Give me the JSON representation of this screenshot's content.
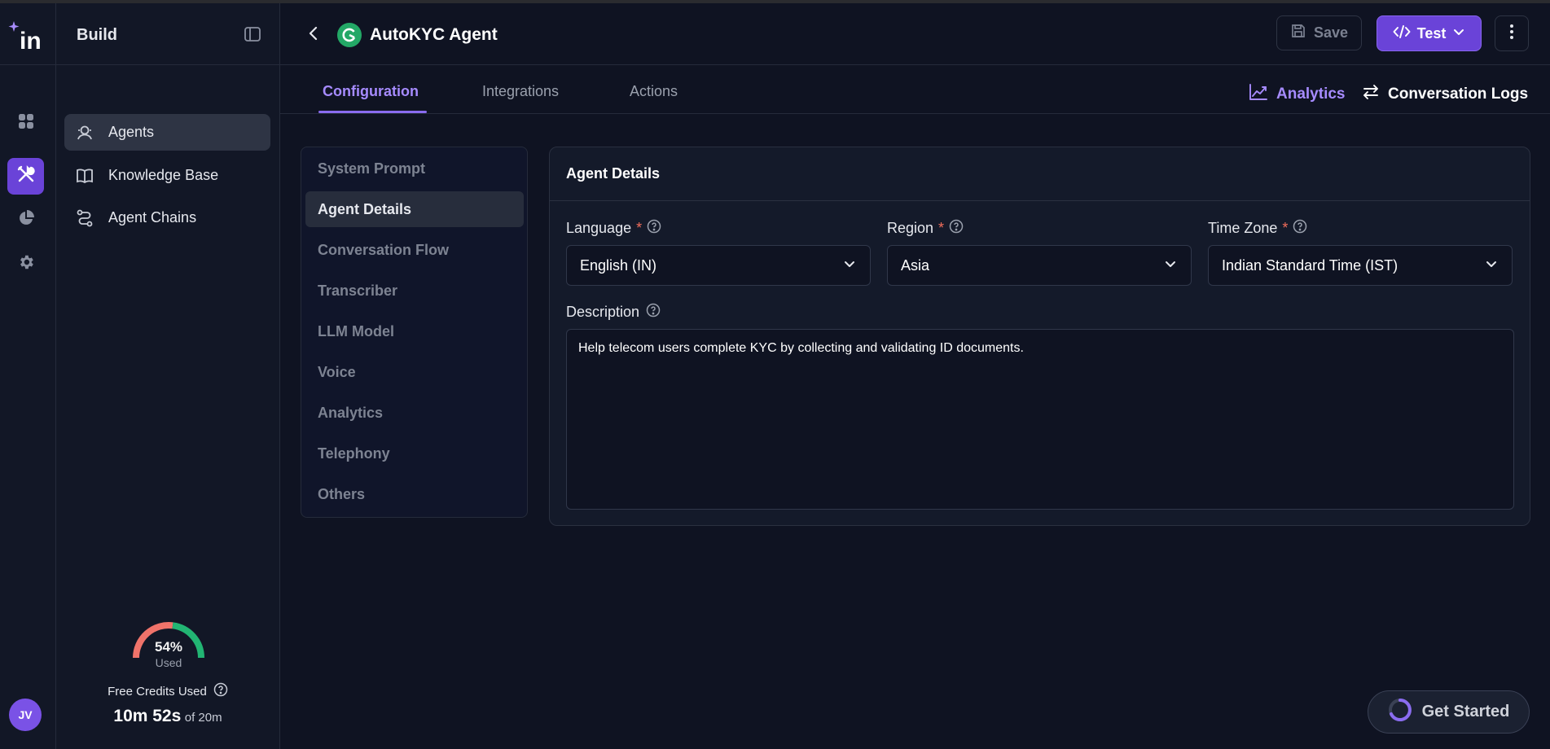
{
  "brand": {
    "logo_text": "in"
  },
  "rail": {
    "items": [
      {
        "icon": "grid-icon"
      },
      {
        "icon": "tools-icon",
        "active": true
      },
      {
        "icon": "pie-chart-icon"
      },
      {
        "icon": "gear-icon"
      }
    ],
    "avatar_initials": "JV"
  },
  "sidebar": {
    "title": "Build",
    "items": [
      {
        "label": "Agents",
        "icon": "agent-icon",
        "active": true
      },
      {
        "label": "Knowledge Base",
        "icon": "book-icon"
      },
      {
        "label": "Agent Chains",
        "icon": "chain-icon"
      }
    ],
    "credits": {
      "percent": 54,
      "percent_label": "54%",
      "used_label": "Used",
      "label": "Free Credits Used",
      "value": "10m 52s",
      "of": "of 20m"
    }
  },
  "header": {
    "agent_name": "AutoKYC Agent",
    "save_label": "Save",
    "test_label": "Test"
  },
  "tabs": {
    "items": [
      "Configuration",
      "Integrations",
      "Actions"
    ],
    "active": "Configuration",
    "analytics_label": "Analytics",
    "logs_label": "Conversation Logs"
  },
  "subnav": {
    "items": [
      "System Prompt",
      "Agent Details",
      "Conversation Flow",
      "Transcriber",
      "LLM Model",
      "Voice",
      "Analytics",
      "Telephony",
      "Others"
    ],
    "active": "Agent Details"
  },
  "panel": {
    "title": "Agent Details",
    "language": {
      "label": "Language",
      "value": "English (IN)"
    },
    "region": {
      "label": "Region",
      "value": "Asia"
    },
    "timezone": {
      "label": "Time Zone",
      "value": "Indian Standard Time (IST)"
    },
    "description": {
      "label": "Description",
      "value": "Help telecom users complete KYC by collecting and validating ID documents."
    },
    "required_mark": "*"
  },
  "get_started_label": "Get Started",
  "colors": {
    "accent": "#6a43d8",
    "accent_text": "#a68bff",
    "gauge_red": "#f0736a",
    "gauge_green": "#22b573"
  }
}
